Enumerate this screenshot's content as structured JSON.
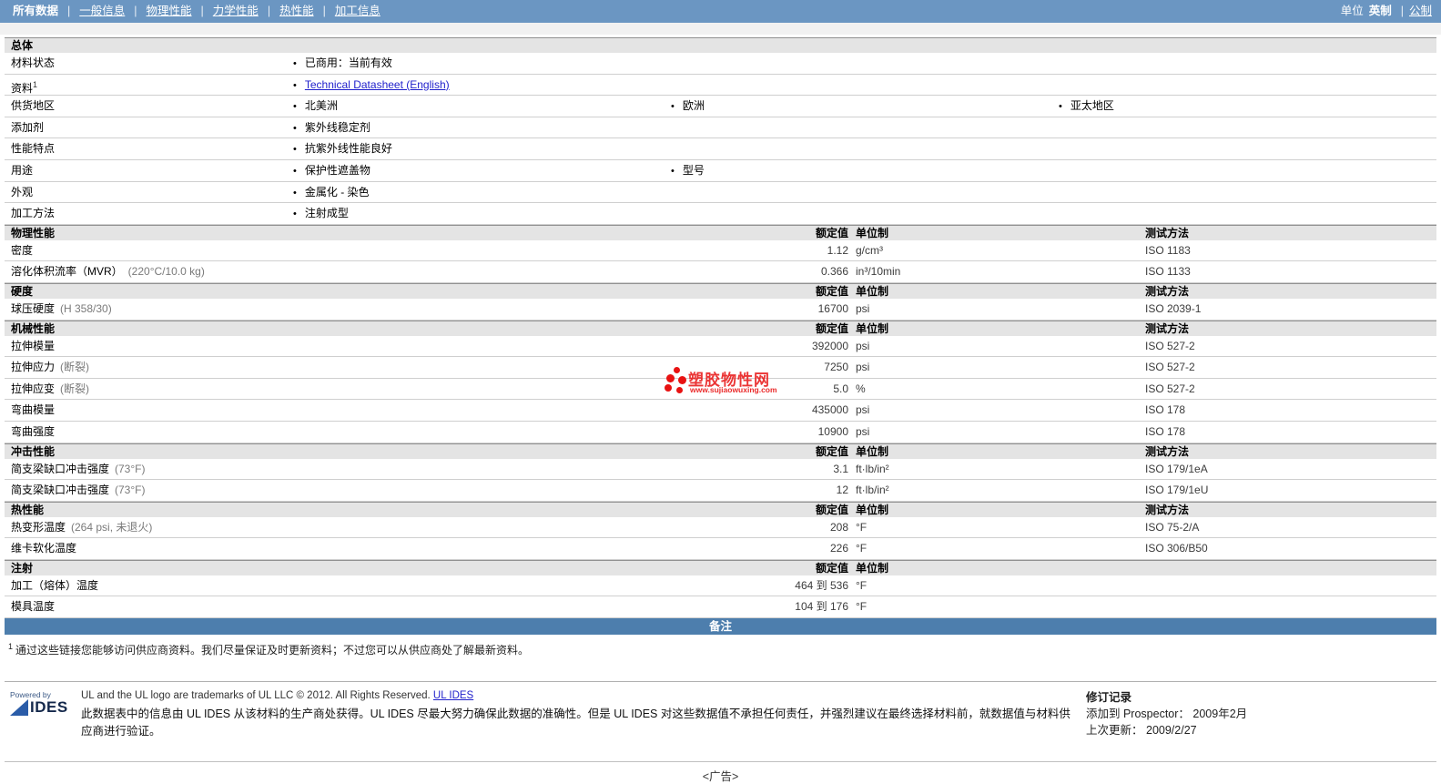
{
  "colors": {
    "nav_blue": "#6b96c2",
    "banner_blue": "#4d7ead",
    "link_blue": "#2222cc",
    "watermark_red": "#e81212"
  },
  "nav": {
    "items": [
      {
        "label": "所有数据",
        "active": true
      },
      {
        "label": "一般信息",
        "active": false
      },
      {
        "label": "物理性能",
        "active": false
      },
      {
        "label": "力学性能",
        "active": false
      },
      {
        "label": "热性能",
        "active": false
      },
      {
        "label": "加工信息",
        "active": false
      }
    ],
    "units_label": "单位",
    "unit_active": "英制",
    "unit_link": "公制"
  },
  "table": {
    "col_headers": {
      "value": "额定值",
      "unit": "单位制",
      "method": "测试方法"
    },
    "general_section": {
      "title": "总体",
      "rows": [
        {
          "label": "材料状态",
          "sup": "",
          "bullets": [
            {
              "slot": 0,
              "text": "已商用：当前有效",
              "link": false
            }
          ]
        },
        {
          "label": "资料",
          "sup": "1",
          "bullets": [
            {
              "slot": 0,
              "text": "Technical Datasheet (English)",
              "link": true
            }
          ]
        },
        {
          "label": "供货地区",
          "sup": "",
          "bullets": [
            {
              "slot": 0,
              "text": "北美洲",
              "link": false
            },
            {
              "slot": 1,
              "text": "欧洲",
              "link": false
            },
            {
              "slot": 2,
              "text": "亚太地区",
              "link": false
            }
          ]
        },
        {
          "label": "添加剂",
          "sup": "",
          "bullets": [
            {
              "slot": 0,
              "text": "紫外线稳定剂",
              "link": false
            }
          ]
        },
        {
          "label": "性能特点",
          "sup": "",
          "bullets": [
            {
              "slot": 0,
              "text": "抗紫外线性能良好",
              "link": false
            }
          ]
        },
        {
          "label": "用途",
          "sup": "",
          "bullets": [
            {
              "slot": 0,
              "text": "保护性遮盖物",
              "link": false
            },
            {
              "slot": 1,
              "text": "型号",
              "link": false
            }
          ]
        },
        {
          "label": "外观",
          "sup": "",
          "bullets": [
            {
              "slot": 0,
              "text": "金属化 - 染色",
              "link": false
            }
          ]
        },
        {
          "label": "加工方法",
          "sup": "",
          "bullets": [
            {
              "slot": 0,
              "text": "注射成型",
              "link": false
            }
          ]
        }
      ]
    },
    "property_sections": [
      {
        "title": "物理性能",
        "show_method": true,
        "rows": [
          {
            "label": "密度",
            "condition": "",
            "value": "1.12",
            "unit": "g/cm³",
            "method": "ISO 1183"
          },
          {
            "label": "溶化体积流率（MVR）",
            "condition": "(220°C/10.0 kg)",
            "value": "0.366",
            "unit": "in³/10min",
            "method": "ISO 1133"
          }
        ]
      },
      {
        "title": "硬度",
        "show_method": true,
        "rows": [
          {
            "label": "球压硬度",
            "condition": "(H 358/30)",
            "value": "16700",
            "unit": "psi",
            "method": "ISO 2039-1"
          }
        ]
      },
      {
        "title": "机械性能",
        "show_method": true,
        "rows": [
          {
            "label": "拉伸模量",
            "condition": "",
            "value": "392000",
            "unit": "psi",
            "method": "ISO 527-2"
          },
          {
            "label": "拉伸应力",
            "condition": "(断裂)",
            "value": "7250",
            "unit": "psi",
            "method": "ISO 527-2"
          },
          {
            "label": "拉伸应变",
            "condition": "(断裂)",
            "value": "5.0",
            "unit": "%",
            "method": "ISO 527-2"
          },
          {
            "label": "弯曲模量",
            "condition": "",
            "value": "435000",
            "unit": "psi",
            "method": "ISO 178"
          },
          {
            "label": "弯曲强度",
            "condition": "",
            "value": "10900",
            "unit": "psi",
            "method": "ISO 178"
          }
        ]
      },
      {
        "title": "冲击性能",
        "show_method": true,
        "rows": [
          {
            "label": "简支梁缺口冲击强度",
            "condition": "(73°F)",
            "value": "3.1",
            "unit": "ft·lb/in²",
            "method": "ISO 179/1eA"
          },
          {
            "label": "简支梁缺口冲击强度",
            "condition": "(73°F)",
            "value": "12",
            "unit": "ft·lb/in²",
            "method": "ISO 179/1eU"
          }
        ]
      },
      {
        "title": "热性能",
        "show_method": true,
        "rows": [
          {
            "label": "热变形温度",
            "condition": "(264 psi, 未退火)",
            "value": "208",
            "unit": "°F",
            "method": "ISO 75-2/A"
          },
          {
            "label": "维卡软化温度",
            "condition": "",
            "value": "226",
            "unit": "°F",
            "method": "ISO 306/B50"
          }
        ]
      },
      {
        "title": "注射",
        "show_method": false,
        "rows": [
          {
            "label": "加工（熔体）温度",
            "condition": "",
            "value": "464 到 536",
            "unit": "°F",
            "method": ""
          },
          {
            "label": "模具温度",
            "condition": "",
            "value": "104 到 176",
            "unit": "°F",
            "method": ""
          }
        ]
      }
    ]
  },
  "notes": {
    "banner": "备注",
    "footnote_sup": "1",
    "footnote": "通过这些链接您能够访问供应商资料。我们尽量保证及时更新资料；不过您可以从供应商处了解最新资料。"
  },
  "footer": {
    "logo_powered": "Powered by",
    "logo_text": "IDES",
    "line1": "UL and the UL logo are trademarks of UL LLC © 2012. All Rights Reserved.",
    "line1_link": "UL IDES",
    "line2": "此数据表中的信息由 UL IDES 从该材料的生产商处获得。UL IDES 尽最大努力确保此数据的准确性。但是 UL IDES 对这些数据值不承担任何责任，并强烈建议在最终选择材料前，就数据值与材料供应商进行验证。",
    "revision_title": "修订记录",
    "added_label": "添加到 Prospector：",
    "added_value": "2009年2月",
    "updated_label": "上次更新：",
    "updated_value": "2009/2/27"
  },
  "watermark": {
    "name": "塑胶物性网",
    "url": "www.sujiaowuxing.com"
  },
  "ad_label": "<广告>"
}
